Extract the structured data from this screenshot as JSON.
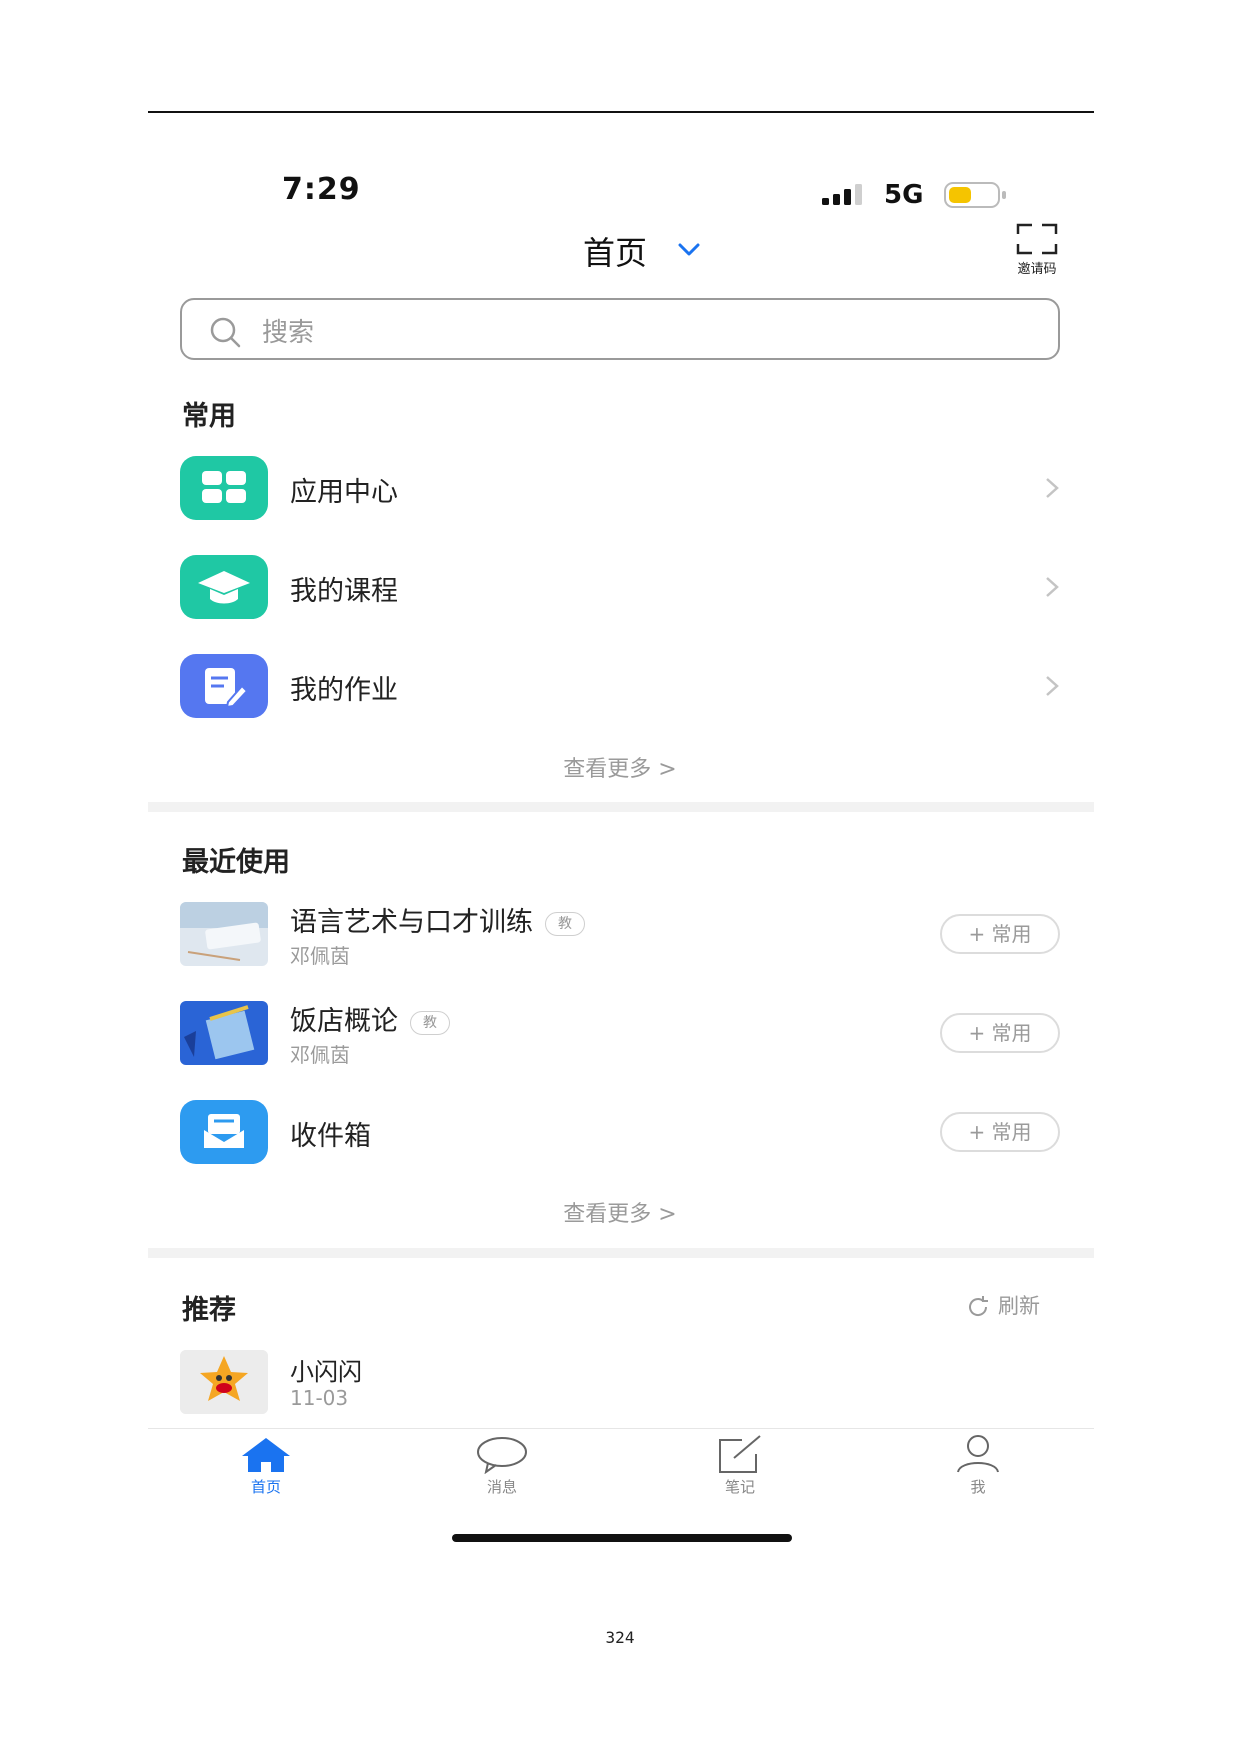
{
  "status_bar": {
    "time": "7:29",
    "network": "5G"
  },
  "nav": {
    "title": "首页",
    "invite_label": "邀请码"
  },
  "search": {
    "placeholder": "搜索"
  },
  "common": {
    "title": "常用",
    "items": [
      {
        "label": "应用中心",
        "icon": "app-center-icon",
        "color": "#1fc8a4"
      },
      {
        "label": "我的课程",
        "icon": "graduation-cap-icon",
        "color": "#1fc8a4"
      },
      {
        "label": "我的作业",
        "icon": "homework-edit-icon",
        "color": "#5577f0"
      }
    ],
    "see_more": "查看更多 >"
  },
  "recent": {
    "title": "最近使用",
    "items": [
      {
        "title": "语言艺术与口才训练",
        "badge": "教",
        "subtitle": "邓佩茵",
        "add_label": "+ 常用"
      },
      {
        "title": "饭店概论",
        "badge": "教",
        "subtitle": "邓佩茵",
        "add_label": "+ 常用"
      },
      {
        "title": "收件箱",
        "icon": "inbox-mail-icon",
        "color": "#2d9bf0",
        "add_label": "+ 常用"
      }
    ],
    "see_more": "查看更多 >"
  },
  "recommend": {
    "title": "推荐",
    "refresh_label": "刷新",
    "items": [
      {
        "title": "小闪闪",
        "date": "11-03"
      }
    ]
  },
  "tabbar": {
    "active_color": "#1a73f0",
    "tabs": [
      {
        "label": "首页",
        "icon": "home-icon",
        "active": true
      },
      {
        "label": "消息",
        "icon": "chat-bubble-icon",
        "active": false
      },
      {
        "label": "笔记",
        "icon": "note-edit-icon",
        "active": false
      },
      {
        "label": "我",
        "icon": "user-icon",
        "active": false
      }
    ]
  },
  "page_number": "324"
}
